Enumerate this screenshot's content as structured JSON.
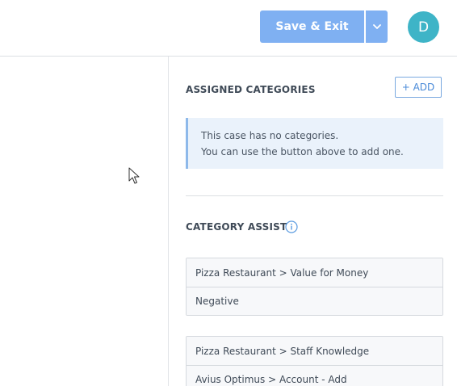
{
  "header": {
    "save_label": "Save & Exit",
    "avatar_initial": "D"
  },
  "assigned": {
    "title": "ASSIGNED CATEGORIES",
    "add_label": "+ ADD",
    "empty_line1": "This case has no categories.",
    "empty_line2": "You can use the button above to add one."
  },
  "assist": {
    "title": "CATEGORY ASSIST",
    "suggestions": [
      {
        "category": "Pizza Restaurant > Value for Money",
        "sentiment": "Negative"
      },
      {
        "category": "Pizza Restaurant > Staff Knowledge",
        "sentiment": "Avius Optimus > Account - Add"
      }
    ]
  },
  "colors": {
    "primary_button": "#7fb0f2",
    "avatar": "#3eb4c7",
    "info_background": "#eaf2fb",
    "accent": "#4a8ad8"
  },
  "icons": [
    "chevron-down-icon",
    "info-icon",
    "mouse-cursor-icon"
  ]
}
